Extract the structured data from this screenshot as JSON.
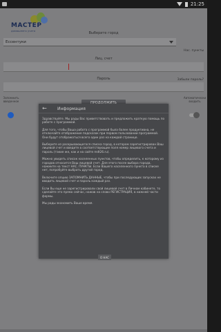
{
  "status_bar": {
    "time": "21:25"
  },
  "logo": {
    "word": "МАСТЕР",
    "subtitle": "домашнего учета"
  },
  "form": {
    "city_label": "Выберите город",
    "city_value": "Ессентуки",
    "settlements_link": "Нас. пункты",
    "account_label": "Лиц. счет",
    "password_label": "Пароль",
    "forgot_link": "Забыли пароль?",
    "login_button": "ПРОДОЛЖИТЬ",
    "remember_label": "Запомнить введенное",
    "autologin_label": "Автоматически входить"
  },
  "dialog": {
    "title": "Информация",
    "paragraphs": [
      "Здравствуйте. Мы рады Вас приветствовать и предложить краткую помощь по работе с программой.",
      "Для того, чтобы Ваша работа с программой была более продуктивна, не отключайте отображение подсказок при первом пользовании программой. Они будут отображаться всего один раз на каждой странице.",
      "Выберите из раскрывающегося списка город, в котором зарегистрирован Ваш лицевой счет и введите в соответствующие поля номер лицевого счета и пароль (такие же, как и на сайте mdt26.ru).",
      "Можно увидеть список населенных пунктов, чтобы определить, к которому из городов относится Ваш лицевой счет. Для этого после выбора города, нажмите на текст НАС. ПУНКТЫ. Если Вашего населенного пункта в списке нет, попробуйте выбрать другой город.",
      "Включите опцию ЗАПОМНИТЬ ДАННЫЕ, чтобы при последующих запусках не вводить лицевой счет и пароль каждый раз.",
      "Если Вы еще не зарегистрировали свой лицевой счет в Личном кабинете, то сделайте это прямо сейчас, нажав на слово РЕГИСТРАЦИЯ, в нижней части формы.",
      "Мы рады экономить Ваше время."
    ],
    "about_button": "О НАС"
  }
}
